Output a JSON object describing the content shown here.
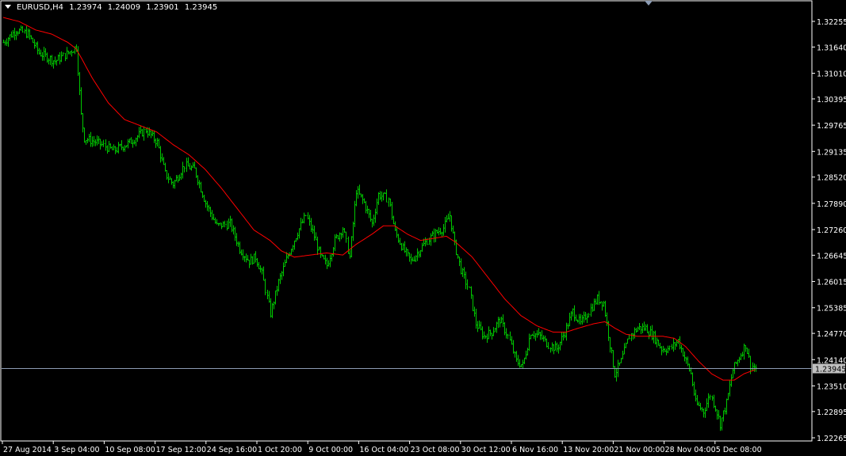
{
  "header": {
    "symbol": "EURUSD,H4",
    "open": "1.23974",
    "high": "1.24009",
    "low": "1.23901",
    "close": "1.23945"
  },
  "colors": {
    "background": "#000000",
    "bars": "#00c800",
    "moving_average": "#ff0000",
    "bid_line": "#8c9cb4",
    "axis": "#ffffff"
  },
  "chart_data": {
    "type": "ohlc-bar",
    "symbol": "EURUSD",
    "timeframe": "H4",
    "current_price": 1.23945,
    "price_axis": {
      "min": 1.22265,
      "max": 1.32255,
      "ticks": [
        "1.32255",
        "1.31640",
        "1.31010",
        "1.30395",
        "1.29765",
        "1.29135",
        "1.28520",
        "1.27890",
        "1.27260",
        "1.26645",
        "1.26015",
        "1.25385",
        "1.24770",
        "1.24140",
        "1.23510",
        "1.22895",
        "1.22265"
      ]
    },
    "time_axis": {
      "ticks": [
        "27 Aug 2014",
        "3 Sep 04:00",
        "10 Sep 08:00",
        "17 Sep 12:00",
        "24 Sep 16:00",
        "1 Oct 20:00",
        "9 Oct 00:00",
        "16 Oct 04:00",
        "23 Oct 08:00",
        "30 Oct 12:00",
        "6 Nov 16:00",
        "13 Nov 20:00",
        "21 Nov 00:00",
        "28 Nov 04:00",
        "5 Dec 08:00"
      ]
    },
    "close_anchors": [
      [
        0,
        1.3175
      ],
      [
        8,
        1.3205
      ],
      [
        15,
        1.3195
      ],
      [
        22,
        1.315
      ],
      [
        32,
        1.313
      ],
      [
        40,
        1.315
      ],
      [
        45,
        1.3165
      ],
      [
        48,
        1.3
      ],
      [
        50,
        1.2945
      ],
      [
        58,
        1.2935
      ],
      [
        68,
        1.2915
      ],
      [
        78,
        1.2935
      ],
      [
        88,
        1.2965
      ],
      [
        95,
        1.2935
      ],
      [
        100,
        1.286
      ],
      [
        105,
        1.2835
      ],
      [
        112,
        1.288
      ],
      [
        118,
        1.287
      ],
      [
        125,
        1.279
      ],
      [
        132,
        1.2735
      ],
      [
        140,
        1.274
      ],
      [
        146,
        1.268
      ],
      [
        152,
        1.265
      ],
      [
        156,
        1.266
      ],
      [
        160,
        1.262
      ],
      [
        165,
        1.2525
      ],
      [
        170,
        1.26
      ],
      [
        176,
        1.2665
      ],
      [
        182,
        1.272
      ],
      [
        187,
        1.276
      ],
      [
        192,
        1.271
      ],
      [
        196,
        1.266
      ],
      [
        200,
        1.264
      ],
      [
        205,
        1.27
      ],
      [
        210,
        1.273
      ],
      [
        214,
        1.266
      ],
      [
        218,
        1.282
      ],
      [
        223,
        1.279
      ],
      [
        228,
        1.274
      ],
      [
        232,
        1.281
      ],
      [
        238,
        1.28
      ],
      [
        242,
        1.272
      ],
      [
        247,
        1.268
      ],
      [
        252,
        1.265
      ],
      [
        258,
        1.268
      ],
      [
        262,
        1.27
      ],
      [
        268,
        1.272
      ],
      [
        272,
        1.273
      ],
      [
        276,
        1.276
      ],
      [
        279,
        1.269
      ],
      [
        283,
        1.263
      ],
      [
        288,
        1.258
      ],
      [
        292,
        1.25
      ],
      [
        297,
        1.247
      ],
      [
        302,
        1.248
      ],
      [
        307,
        1.251
      ],
      [
        312,
        1.247
      ],
      [
        317,
        1.241
      ],
      [
        321,
        1.24
      ],
      [
        326,
        1.248
      ],
      [
        332,
        1.247
      ],
      [
        337,
        1.245
      ],
      [
        342,
        1.244
      ],
      [
        347,
        1.248
      ],
      [
        352,
        1.253
      ],
      [
        357,
        1.25
      ],
      [
        362,
        1.253
      ],
      [
        367,
        1.256
      ],
      [
        371,
        1.255
      ],
      [
        375,
        1.245
      ],
      [
        378,
        1.238
      ],
      [
        382,
        1.241
      ],
      [
        387,
        1.247
      ],
      [
        392,
        1.249
      ],
      [
        397,
        1.249
      ],
      [
        402,
        1.247
      ],
      [
        407,
        1.244
      ],
      [
        412,
        1.244
      ],
      [
        417,
        1.246
      ],
      [
        421,
        1.242
      ],
      [
        425,
        1.238
      ],
      [
        428,
        1.231
      ],
      [
        433,
        1.229
      ],
      [
        437,
        1.233
      ],
      [
        440,
        1.23
      ],
      [
        443,
        1.226
      ],
      [
        447,
        1.231
      ],
      [
        451,
        1.239
      ],
      [
        455,
        1.242
      ],
      [
        459,
        1.245
      ],
      [
        462,
        1.24
      ],
      [
        465,
        1.23945
      ]
    ],
    "moving_average_anchors": [
      [
        0,
        1.3235
      ],
      [
        10,
        1.3225
      ],
      [
        20,
        1.3205
      ],
      [
        30,
        1.3195
      ],
      [
        40,
        1.3175
      ],
      [
        45,
        1.316
      ],
      [
        48,
        1.314
      ],
      [
        55,
        1.309
      ],
      [
        65,
        1.303
      ],
      [
        75,
        1.299
      ],
      [
        85,
        1.2975
      ],
      [
        95,
        1.296
      ],
      [
        105,
        1.293
      ],
      [
        115,
        1.2905
      ],
      [
        125,
        1.287
      ],
      [
        135,
        1.2825
      ],
      [
        145,
        1.2775
      ],
      [
        155,
        1.2725
      ],
      [
        165,
        1.27
      ],
      [
        172,
        1.2675
      ],
      [
        180,
        1.266
      ],
      [
        190,
        1.2665
      ],
      [
        200,
        1.267
      ],
      [
        210,
        1.2665
      ],
      [
        218,
        1.269
      ],
      [
        228,
        1.2715
      ],
      [
        235,
        1.2735
      ],
      [
        242,
        1.2735
      ],
      [
        250,
        1.2715
      ],
      [
        258,
        1.27
      ],
      [
        266,
        1.2705
      ],
      [
        274,
        1.271
      ],
      [
        280,
        1.2695
      ],
      [
        290,
        1.266
      ],
      [
        300,
        1.261
      ],
      [
        310,
        1.256
      ],
      [
        320,
        1.252
      ],
      [
        330,
        1.2495
      ],
      [
        340,
        1.248
      ],
      [
        348,
        1.248
      ],
      [
        356,
        1.249
      ],
      [
        365,
        1.25
      ],
      [
        372,
        1.2505
      ],
      [
        378,
        1.249
      ],
      [
        385,
        1.2475
      ],
      [
        392,
        1.247
      ],
      [
        400,
        1.247
      ],
      [
        408,
        1.247
      ],
      [
        415,
        1.2465
      ],
      [
        422,
        1.2445
      ],
      [
        430,
        1.241
      ],
      [
        438,
        1.238
      ],
      [
        445,
        1.2365
      ],
      [
        452,
        1.2365
      ],
      [
        458,
        1.238
      ],
      [
        465,
        1.239
      ]
    ]
  }
}
